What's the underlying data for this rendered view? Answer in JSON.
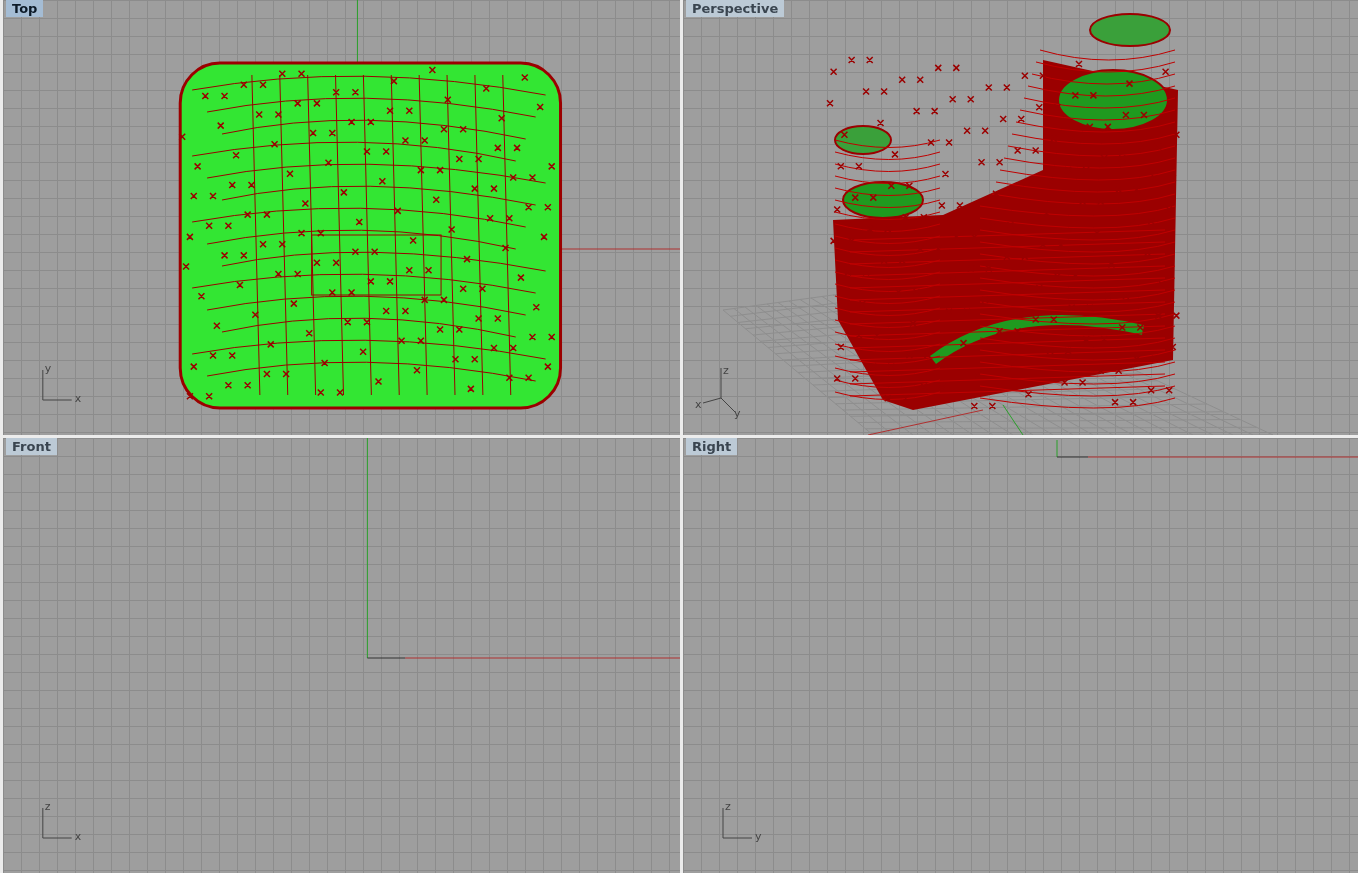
{
  "viewports": [
    {
      "title": "Top",
      "selected": true,
      "kind": "top",
      "axis_labels": [
        "y",
        "x"
      ]
    },
    {
      "title": "Perspective",
      "selected": false,
      "kind": "perspective",
      "axis_labels": [
        "z",
        "x",
        "y"
      ]
    },
    {
      "title": "Front",
      "selected": false,
      "kind": "front",
      "axis_labels": [
        "z",
        "x"
      ]
    },
    {
      "title": "Right",
      "selected": false,
      "kind": "right",
      "axis_labels": [
        "z",
        "y"
      ]
    }
  ]
}
